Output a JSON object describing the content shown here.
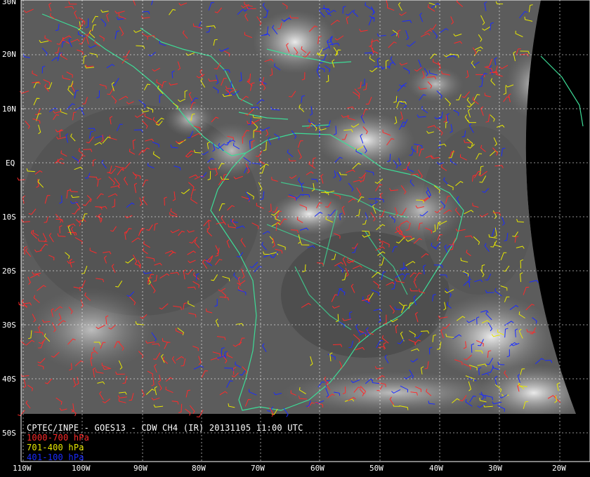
{
  "product": {
    "title": "CPTEC/INPE - GOES13 - CDW CH4 (IR) 20131105 11:00 UTC"
  },
  "legend": [
    {
      "label": "1000-700 hPa",
      "color": "#ff2a2a"
    },
    {
      "label": "701-400 hPa",
      "color": "#e8e800"
    },
    {
      "label": "401-100 hPa",
      "color": "#1a2cff"
    }
  ],
  "latitude_labels": [
    "30N",
    "20N",
    "10N",
    "EQ",
    "10S",
    "20S",
    "30S",
    "40S",
    "50S"
  ],
  "longitude_labels": [
    "110W",
    "100W",
    "90W",
    "80W",
    "70W",
    "60W",
    "50W",
    "40W",
    "30W",
    "20W"
  ],
  "colors": {
    "coastline": "#3ddc97",
    "graticule": "#ffffff",
    "space": "#000000",
    "cloud_bright": "#e6e6e6",
    "cloud_dark": "#4a4a4a"
  }
}
